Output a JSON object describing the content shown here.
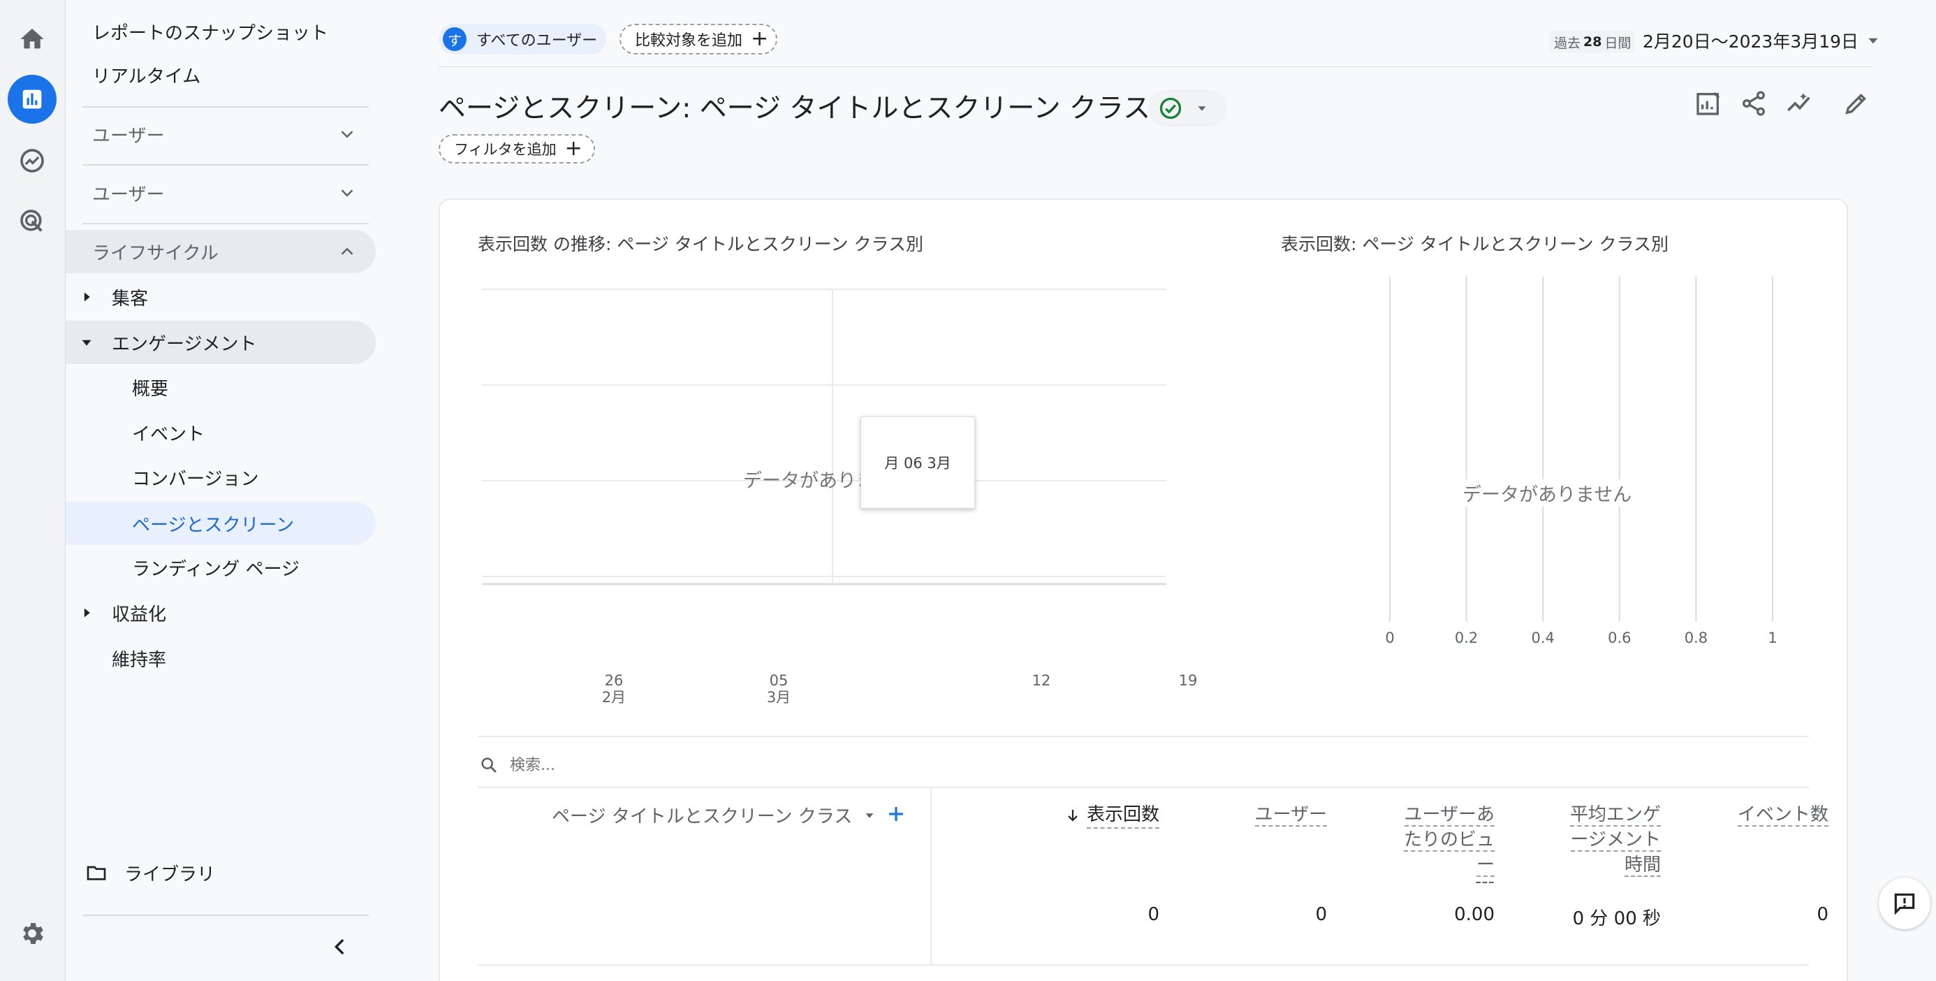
{
  "rail": {
    "icons": [
      "home-icon",
      "reports-icon",
      "explore-icon",
      "advertising-icon",
      "settings-icon"
    ]
  },
  "sidebar": {
    "top_items": [
      "レポートのスナップショット",
      "リアルタイム"
    ],
    "groups": [
      "ユーザー",
      "ユーザー",
      "ライフサイクル"
    ],
    "sections": {
      "acquisition": "集客",
      "engagement": "エンゲージメント",
      "monetization": "収益化",
      "retention": "維持率"
    },
    "engagement_items": [
      "概要",
      "イベント",
      "コンバージョン",
      "ページとスクリーン",
      "ランディング ページ"
    ],
    "library": "ライブラリ"
  },
  "header": {
    "segment_avatar": "す",
    "segment_label": "すべてのユーザー",
    "compare_label": "比較対象を追加",
    "date_prefix": "過去",
    "date_days": "28",
    "date_unit": "日間",
    "date_range": "2月20日〜2023年3月19日",
    "page_title": "ページとスクリーン: ページ タイトルとスクリーン クラス",
    "filter_label": "フィルタを追加"
  },
  "chart_data": [
    {
      "type": "line",
      "title": "表示回数 の推移: ページ タイトルとスクリーン クラス別",
      "x_ticks": [
        {
          "day": "26",
          "month": "2月"
        },
        {
          "day": "05",
          "month": "3月"
        },
        {
          "day": "12",
          "month": ""
        },
        {
          "day": "19",
          "month": ""
        }
      ],
      "series": [],
      "empty_message": "データがありません",
      "tooltip": "月 06 3月"
    },
    {
      "type": "bar",
      "title": "表示回数: ページ タイトルとスクリーン クラス別",
      "x_ticks": [
        "0",
        "0.2",
        "0.4",
        "0.6",
        "0.8",
        "1"
      ],
      "xlim": [
        0,
        1
      ],
      "categories": [],
      "values": [],
      "empty_message": "データがありません"
    }
  ],
  "table": {
    "search_placeholder": "検索...",
    "dimension_header": "ページ タイトルとスクリーン クラス",
    "columns": {
      "views": "表示回数",
      "users": "ユーザー",
      "views_per_user": [
        "ユーザーあ",
        "たりのビュ",
        "ー",
        "---"
      ],
      "avg_engagement": [
        "平均エンゲ",
        "ージメント",
        "時間"
      ],
      "events": "イベント数"
    },
    "totals": {
      "views": "0",
      "users": "0",
      "views_per_user": "0.00",
      "avg_engagement": "0 分 00 秒",
      "events": "0"
    }
  },
  "colors": {
    "accent": "#1a73e8",
    "success": "#188038"
  }
}
